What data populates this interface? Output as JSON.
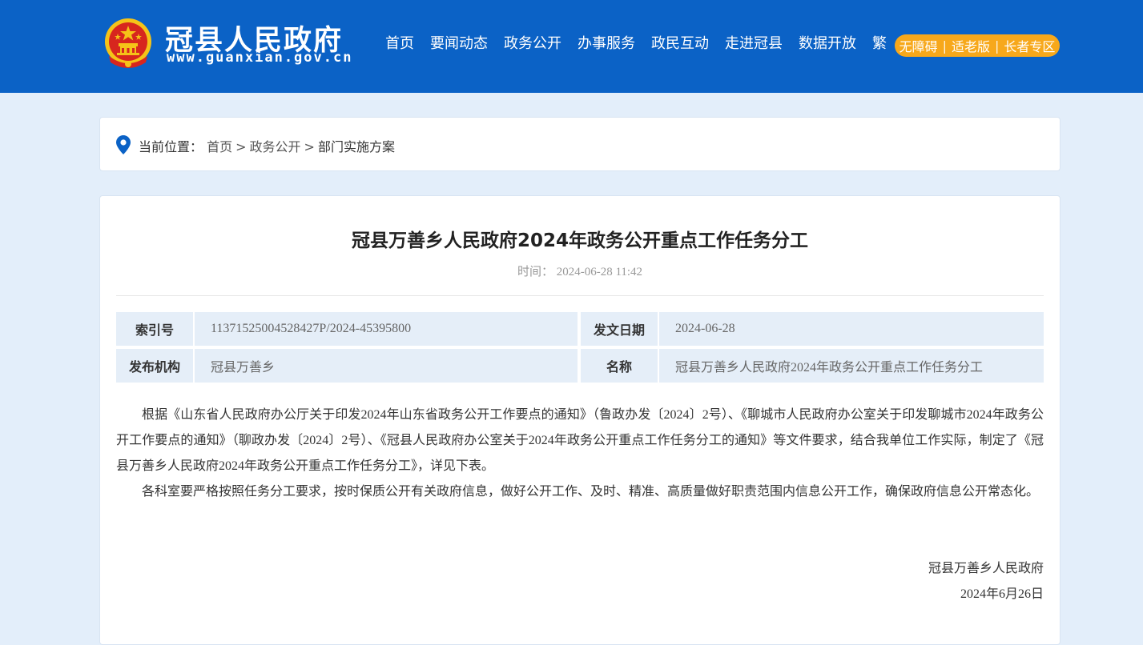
{
  "header": {
    "site_title": "冠县人民政府",
    "site_domain": "www.guanxian.gov.cn",
    "logo_icon": "national-emblem-icon",
    "nav": [
      "首页",
      "要闻动态",
      "政务公开",
      "办事服务",
      "政民互动",
      "走进冠县",
      "数据开放",
      "繁"
    ],
    "accessibility": [
      "无障碍",
      "适老版",
      "长者专区"
    ],
    "accessibility_separator": "|",
    "colors": {
      "header_bg": "#0b62c6",
      "accessibility_bg": "#f7a81b"
    }
  },
  "breadcrumb": {
    "icon": "location-pin-icon",
    "label": "当前位置：",
    "items": [
      "首页",
      "政务公开",
      "部门实施方案"
    ],
    "separator": ">"
  },
  "article": {
    "title": "冠县万善乡人民政府2024年政务公开重点工作任务分工",
    "time_label": "时间：",
    "time_value": "2024-06-28 11:42",
    "meta": [
      {
        "label": "索引号",
        "value": "11371525004528427P/2024-45395800",
        "label2": "发文日期",
        "value2": "2024-06-28"
      },
      {
        "label": "发布机构",
        "value": "冠县万善乡",
        "label2": "名称",
        "value2": "冠县万善乡人民政府2024年政务公开重点工作任务分工"
      }
    ],
    "paragraphs": [
      "根据《山东省人民政府办公厅关于印发2024年山东省政务公开工作要点的通知》（鲁政办发〔2024〕2号）、《聊城市人民政府办公室关于印发聊城市2024年政务公开工作要点的通知》（聊政办发〔2024〕2号）、《冠县人民政府办公室关于2024年政务公开重点工作任务分工的通知》等文件要求，结合我单位工作实际，制定了《冠县万善乡人民政府2024年政务公开重点工作任务分工》，详见下表。",
      "各科室要严格按照任务分工要求，按时保质公开有关政府信息，做好公开工作、及时、精准、高质量做好职责范围内信息公开工作，确保政府信息公开常态化。"
    ],
    "signature_org": "冠县万善乡人民政府",
    "signature_date": "2024年6月26日"
  }
}
